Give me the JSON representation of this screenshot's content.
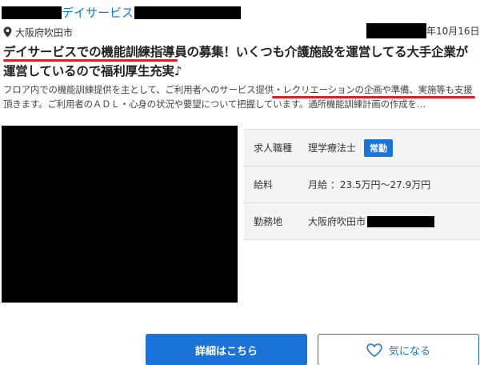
{
  "listing": {
    "facility_name": "デイサービス",
    "location": "大阪府吹田市",
    "date": "年10月16日",
    "headline": "デイサービスでの機能訓練指導員の募集！いくつも介護施設を運営してる大手企業が運営しているので福利厚生充実♪",
    "description": "フロア内での機能訓練提供を主として、ご利用者へのサービス提供・レクリエーションの企画や準備、実施等も支援頂きます。ご利用者のＡＤＬ・心身の状況や要望について把握しています。通所機能訓練計画の作成を…"
  },
  "details": {
    "job_type_label": "求人職種",
    "job_type_value": "理学療法士",
    "employment_badge": "常勤",
    "salary_label": "給料",
    "salary_value": "月給 ：23.5万円〜27.9万円",
    "workplace_label": "勤務地",
    "workplace_value": "大阪府吹田市"
  },
  "actions": {
    "detail_button": "詳細はこちら",
    "favorite_button": "気になる"
  },
  "icons": {
    "location": "map-pin-icon",
    "favorite": "heart-outline-icon"
  },
  "colors": {
    "accent": "#1a73d9",
    "highlight_underline": "#d4242b"
  }
}
